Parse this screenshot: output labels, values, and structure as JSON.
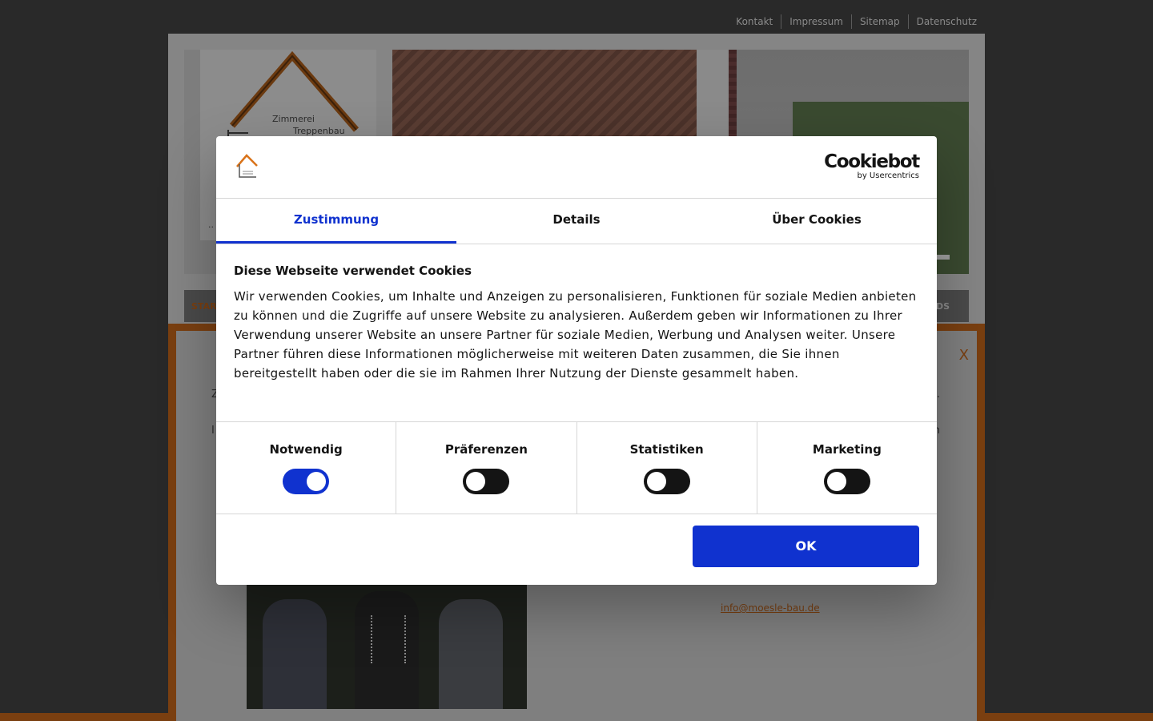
{
  "top_nav": {
    "items": [
      "Kontakt",
      "Impressum",
      "Sitemap",
      "Datenschutz"
    ]
  },
  "logo": {
    "line1": "Zimmerei",
    "line2": "Treppenbau",
    "dots": ".."
  },
  "main_nav": {
    "start_label": "STAR",
    "end_label": "DS"
  },
  "background_popup": {
    "close_label": "X",
    "stub1": "Z",
    "stub2": "I",
    "stub3": ".",
    "stub4": "n",
    "email": "info@moesle-bau.de"
  },
  "cookie_dialog": {
    "brand": "Cookiebot",
    "brand_sub": "by Usercentrics",
    "tabs": [
      "Zustimmung",
      "Details",
      "Über Cookies"
    ],
    "active_tab": "Zustimmung",
    "title": "Diese Webseite verwendet Cookies",
    "text": "Wir verwenden Cookies, um Inhalte und Anzeigen zu personalisieren, Funktionen für soziale Medien anbieten zu können und die Zugriffe auf unsere Website zu analysieren. Außerdem geben wir Informationen zu Ihrer Verwendung unserer Website an unsere Partner für soziale Medien, Werbung und Analysen weiter. Unsere Partner führen diese Informationen möglicherweise mit weiteren Daten zusammen, die Sie ihnen bereitgestellt haben oder die sie im Rahmen Ihrer Nutzung der Dienste gesammelt haben.",
    "categories": [
      {
        "label": "Notwendig",
        "enabled": true
      },
      {
        "label": "Präferenzen",
        "enabled": false
      },
      {
        "label": "Statistiken",
        "enabled": false
      },
      {
        "label": "Marketing",
        "enabled": false
      }
    ],
    "ok_label": "OK",
    "colors": {
      "accent": "#1032cf",
      "text": "#141414",
      "site_orange": "#d9731a"
    }
  }
}
